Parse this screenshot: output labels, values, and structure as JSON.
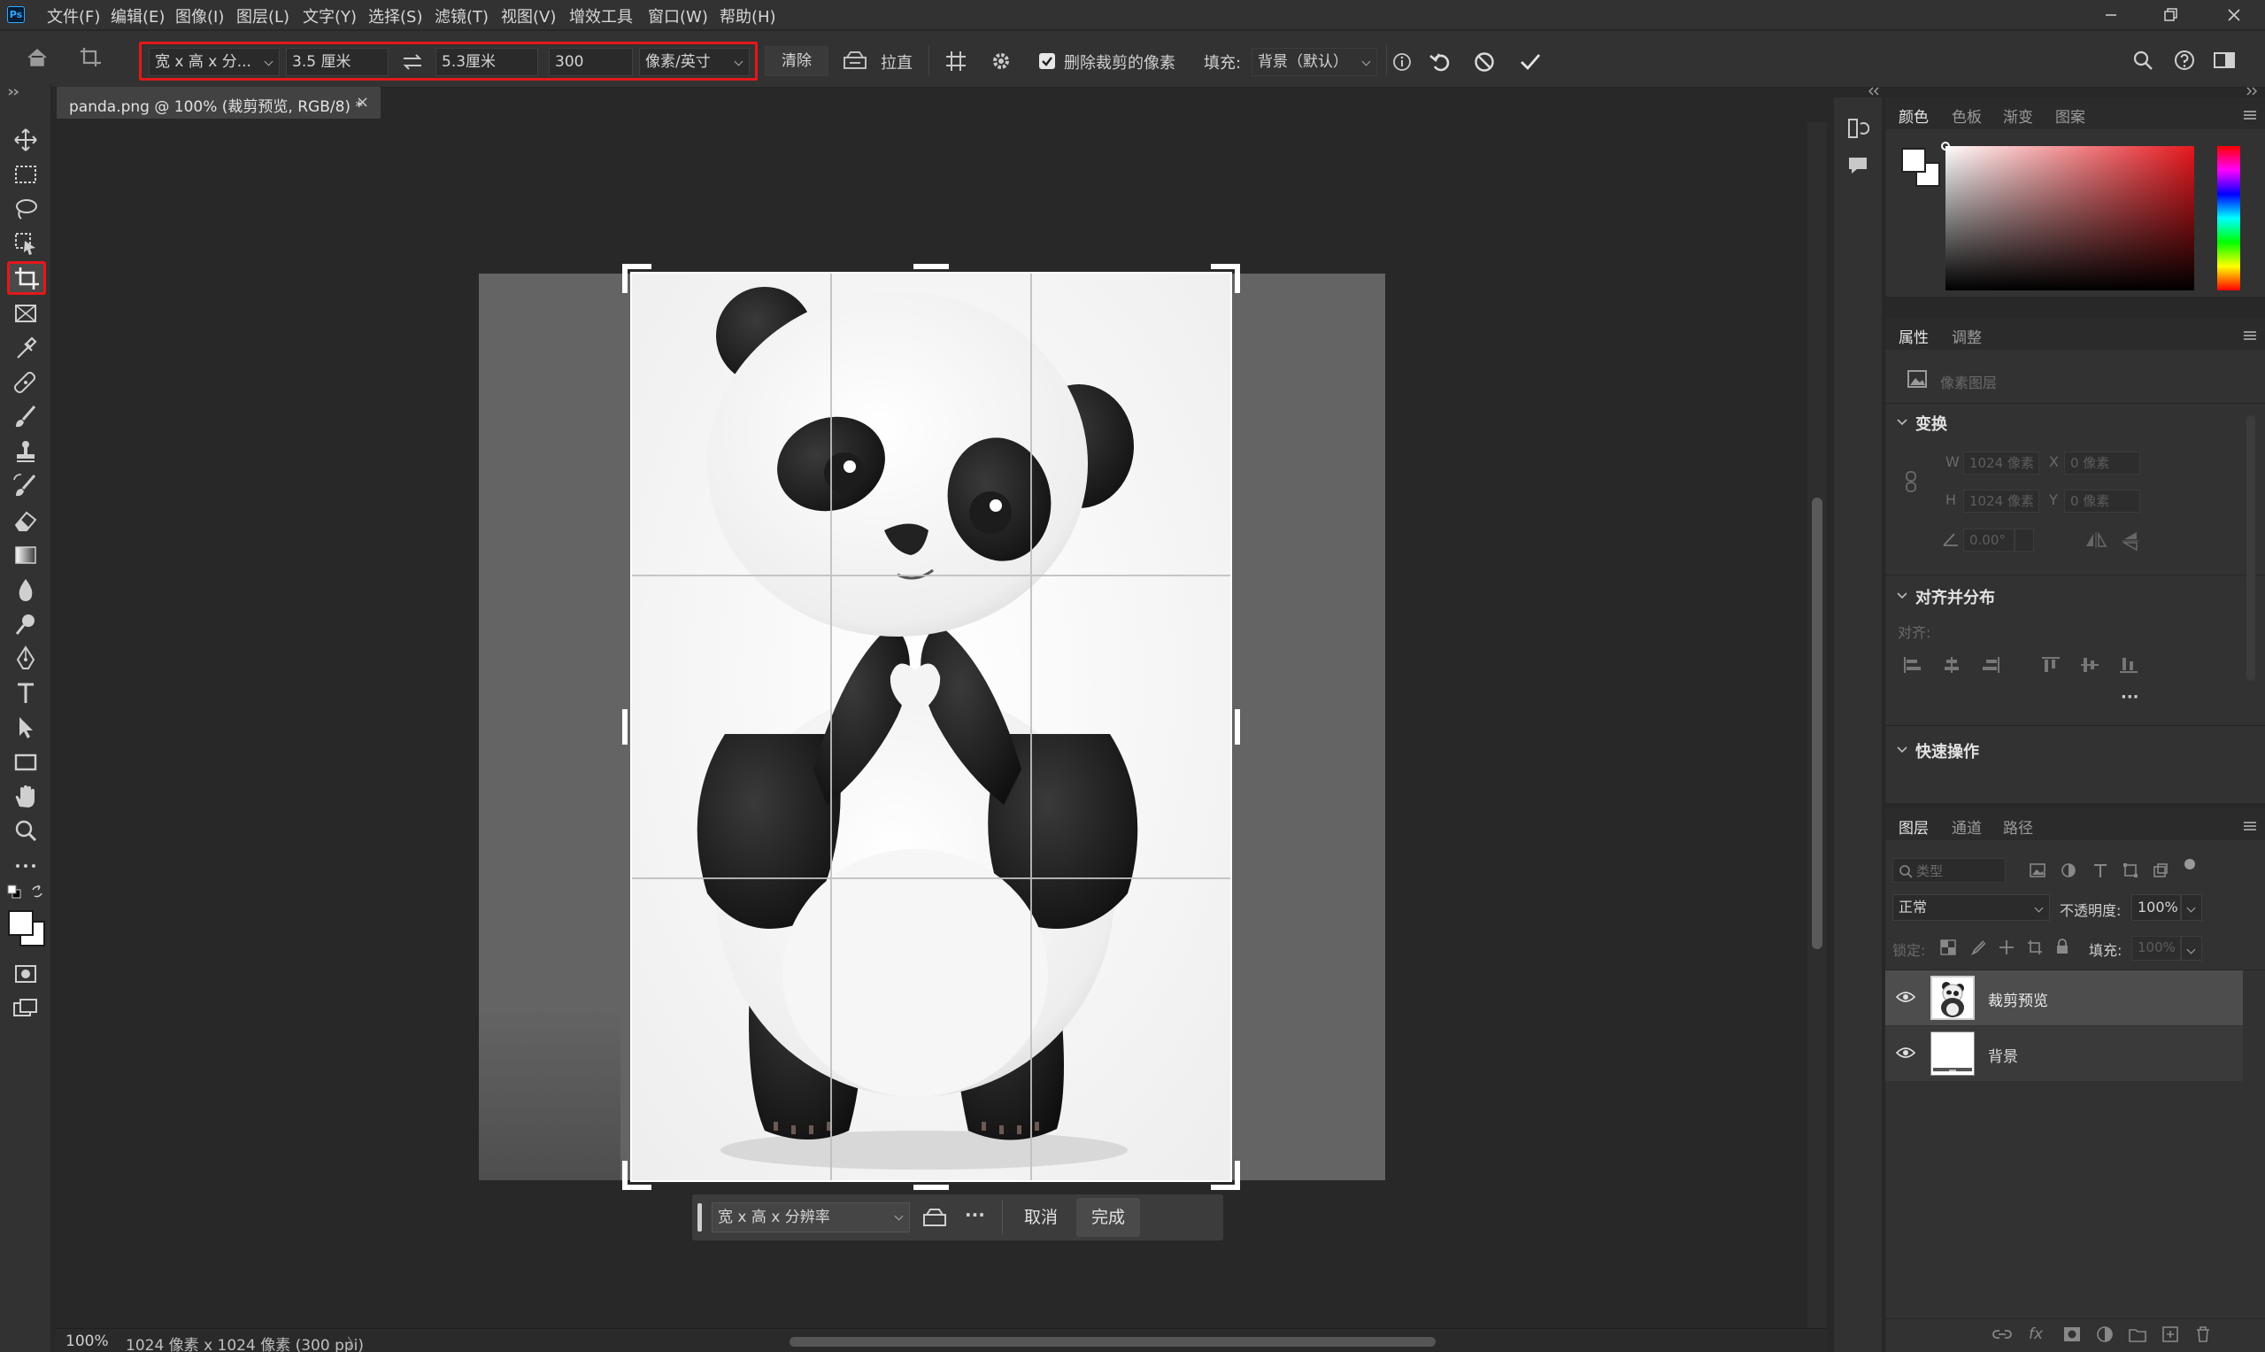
{
  "app": {
    "logo": "Ps"
  },
  "menu": [
    "文件(F)",
    "编辑(E)",
    "图像(I)",
    "图层(L)",
    "文字(Y)",
    "选择(S)",
    "滤镜(T)",
    "视图(V)",
    "增效工具",
    "窗口(W)",
    "帮助(H)"
  ],
  "options_bar": {
    "preset": "宽 x 高 x 分...",
    "width": "3.5 厘米",
    "height": "5.3厘米",
    "resolution": "300",
    "resolution_unit": "像素/英寸",
    "clear_label": "清除",
    "straighten_label": "拉直",
    "delete_cropped_label": "删除裁剪的像素",
    "delete_cropped_checked": true,
    "fill_label": "填充:",
    "fill_value": "背景（默认）",
    "highlight_color": "#e3181b"
  },
  "document": {
    "tab_title": "panda.png @ 100% (裁剪预览, RGB/8) *",
    "close_symbol": "×"
  },
  "crop_bar": {
    "preset": "宽 x 高 x 分辨率",
    "more": "···",
    "cancel_label": "取消",
    "done_label": "完成"
  },
  "status": {
    "zoom": "100%",
    "info": "1024 像素 x 1024 像素 (300 ppi)",
    "arrow": "〉"
  },
  "color_panel": {
    "tabs": [
      "颜色",
      "色板",
      "渐变",
      "图案"
    ],
    "active_tab": 0
  },
  "properties_panel": {
    "tabs": [
      "属性",
      "调整"
    ],
    "layer_type": "像素图层",
    "transform_title": "变换",
    "w_label": "W",
    "w_value": "1024 像素",
    "x_label": "X",
    "x_value": "0 像素",
    "h_label": "H",
    "h_value": "1024 像素",
    "y_label": "Y",
    "y_value": "0 像素",
    "angle_value": "0.00°",
    "align_title": "对齐并分布",
    "align_label": "对齐:",
    "more": "···",
    "quick_actions_title": "快速操作"
  },
  "layers_panel": {
    "tabs": [
      "图层",
      "通道",
      "路径"
    ],
    "search_placeholder": "类型",
    "blend_mode": "正常",
    "opacity_label": "不透明度:",
    "opacity_value": "100%",
    "lock_label": "锁定:",
    "fill_label": "填充:",
    "fill_value": "100%",
    "layers": [
      {
        "name": "裁剪预览",
        "selected": true,
        "visible": true
      },
      {
        "name": "背景",
        "selected": false,
        "visible": true
      }
    ]
  }
}
